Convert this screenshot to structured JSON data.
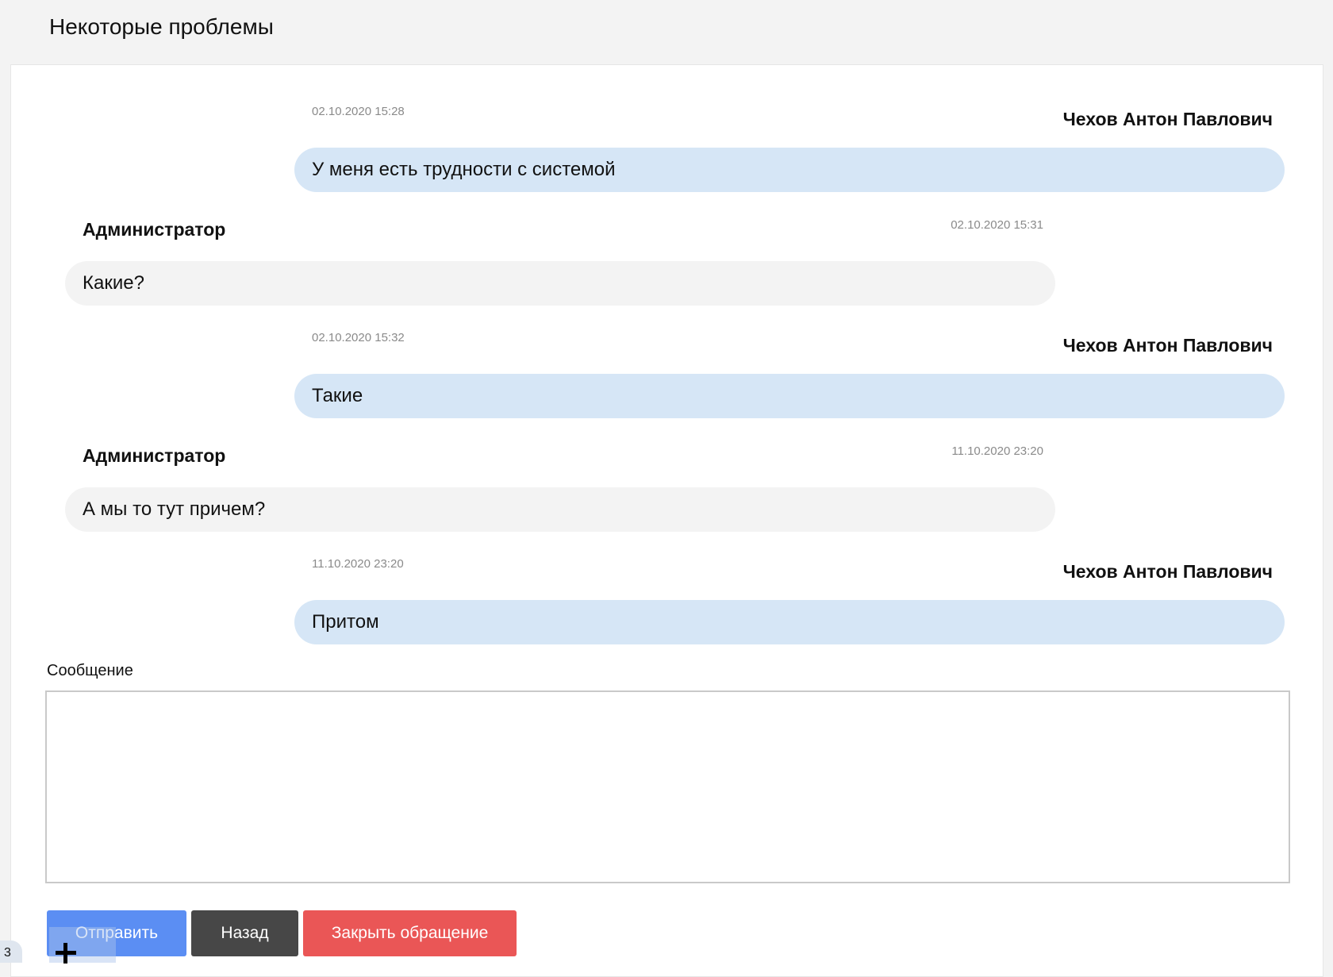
{
  "page": {
    "title": "Некоторые проблемы"
  },
  "messages": [
    {
      "role": "user",
      "author": "Чехов Антон Павлович",
      "time": "02.10.2020 15:28",
      "text": "У меня есть трудности с системой"
    },
    {
      "role": "admin",
      "author": "Администратор",
      "time": "02.10.2020 15:31",
      "text": "Какие?"
    },
    {
      "role": "user",
      "author": "Чехов Антон Павлович",
      "time": "02.10.2020 15:32",
      "text": "Такие"
    },
    {
      "role": "admin",
      "author": "Администратор",
      "time": "11.10.2020 23:20",
      "text": "А мы то тут причем?"
    },
    {
      "role": "user",
      "author": "Чехов Антон Павлович",
      "time": "11.10.2020 23:20",
      "text": "Притом"
    }
  ],
  "compose": {
    "label": "Сообщение",
    "value": "",
    "placeholder": ""
  },
  "actions": {
    "send_label": "Отправить",
    "back_label": "Назад",
    "close_label": "Закрыть обращение"
  },
  "corner": {
    "badge": "3",
    "icon": "plus-icon"
  },
  "colors": {
    "user_bubble": "#d6e6f6",
    "admin_bubble": "#f3f3f3",
    "send": "#5b8ef3",
    "back": "#474747",
    "close": "#ea5656"
  }
}
